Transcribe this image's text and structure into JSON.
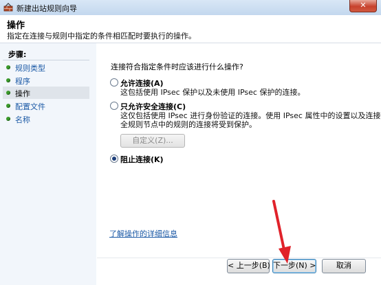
{
  "window": {
    "title": "新建出站规则向导",
    "close_label": "✕"
  },
  "header": {
    "title": "操作",
    "subtitle": "指定在连接与规则中指定的条件相匹配时要执行的操作。"
  },
  "sidebar": {
    "heading": "步骤:",
    "items": [
      {
        "label": "规则类型",
        "active": false
      },
      {
        "label": "程序",
        "active": false
      },
      {
        "label": "操作",
        "active": true
      },
      {
        "label": "配置文件",
        "active": false
      },
      {
        "label": "名称",
        "active": false
      }
    ]
  },
  "main": {
    "question": "连接符合指定条件时应该进行什么操作?",
    "options": [
      {
        "title": "允许连接(A)",
        "desc_lines": [
          "这包括使用 IPsec 保护以及未使用 IPsec 保护的连接。"
        ],
        "checked": false
      },
      {
        "title": "只允许安全连接(C)",
        "desc_lines": [
          "这仅包括使用 IPsec 进行身份验证的连接。使用 IPsec 属性中的设置以及连接安",
          "全规则节点中的规则的连接将受到保护。"
        ],
        "checked": false
      },
      {
        "title": "阻止连接(K)",
        "desc_lines": [],
        "checked": true
      }
    ],
    "customize_label": "自定义(Z)...",
    "learn_more": "了解操作的详细信息"
  },
  "footer": {
    "back_label": "< 上一步(B)",
    "next_label": "下一步(N) >",
    "cancel_label": "取消"
  },
  "colors": {
    "link": "#1c5aa6",
    "bullet": "#3b9a2b",
    "annotation_arrow": "#e0222a"
  }
}
